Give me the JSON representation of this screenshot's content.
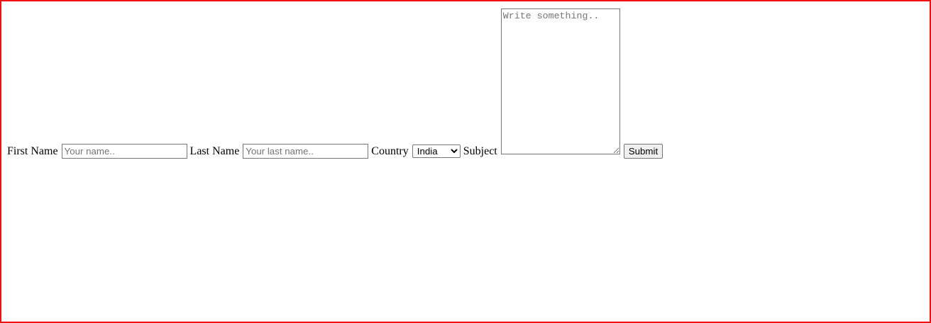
{
  "form": {
    "first_name": {
      "label": "First Name",
      "placeholder": "Your name..",
      "value": ""
    },
    "last_name": {
      "label": "Last Name",
      "placeholder": "Your last name..",
      "value": ""
    },
    "country": {
      "label": "Country",
      "selected": "India"
    },
    "subject": {
      "label": "Subject",
      "placeholder": "Write something..",
      "value": ""
    },
    "submit_label": "Submit"
  },
  "colors": {
    "frame_border": "#ee1111",
    "background": "#ffffff"
  }
}
